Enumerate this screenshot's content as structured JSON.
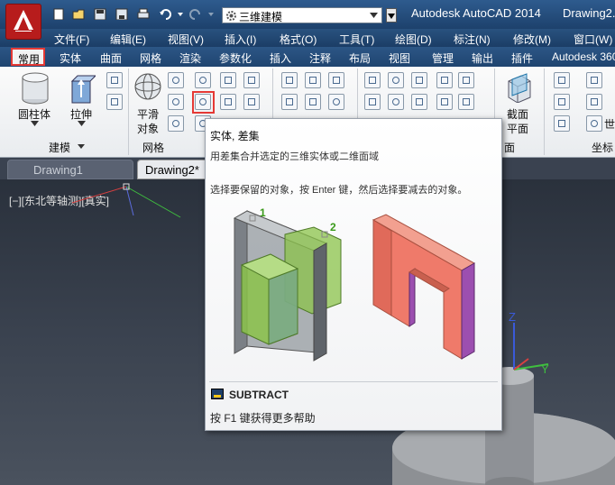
{
  "titlebar": {
    "workspace": "三维建模",
    "app_title": "Autodesk AutoCAD 2014",
    "doc_title": "Drawing2."
  },
  "menubar": {
    "items": [
      "文件(F)",
      "编辑(E)",
      "视图(V)",
      "插入(I)",
      "格式(O)",
      "工具(T)",
      "绘图(D)",
      "标注(N)",
      "修改(M)",
      "窗口(W)"
    ]
  },
  "ribbon_tabs": {
    "items": [
      "常用",
      "实体",
      "曲面",
      "网格",
      "渲染",
      "参数化",
      "插入",
      "注释",
      "布局",
      "视图",
      "管理",
      "输出",
      "插件",
      "Autodesk 360"
    ]
  },
  "ribbon": {
    "cylinder": "圆柱体",
    "extrude": "拉伸",
    "smooth_line1": "平滑",
    "smooth_line2": "对象",
    "section_line1": "截面",
    "section_line2": "平面",
    "panel_modeling": "建模",
    "panel_mesh": "网格",
    "panel_section": "面",
    "panel_coord": "坐标",
    "world": "世"
  },
  "doc_tabs": [
    "Drawing1",
    "Drawing2*"
  ],
  "viewport": {
    "label": "[−][东北等轴测][真实]",
    "axis_x": "X",
    "axis_y": "Y",
    "axis_z": "Z"
  },
  "tooltip": {
    "title": "实体, 差集",
    "description": "用差集合并选定的三维实体或二维面域",
    "instruction": "选择要保留的对象，按 Enter 键，然后选择要减去的对象。",
    "label_1": "1",
    "label_2": "2",
    "command": "SUBTRACT",
    "help": "按 F1 键获得更多帮助"
  },
  "colors": {
    "accent_red": "#e53935",
    "shape_green": "#8bc34a",
    "shape_gray": "#8e959c",
    "result_salmon": "#ef7a6a",
    "result_purple": "#9c4fb0"
  }
}
